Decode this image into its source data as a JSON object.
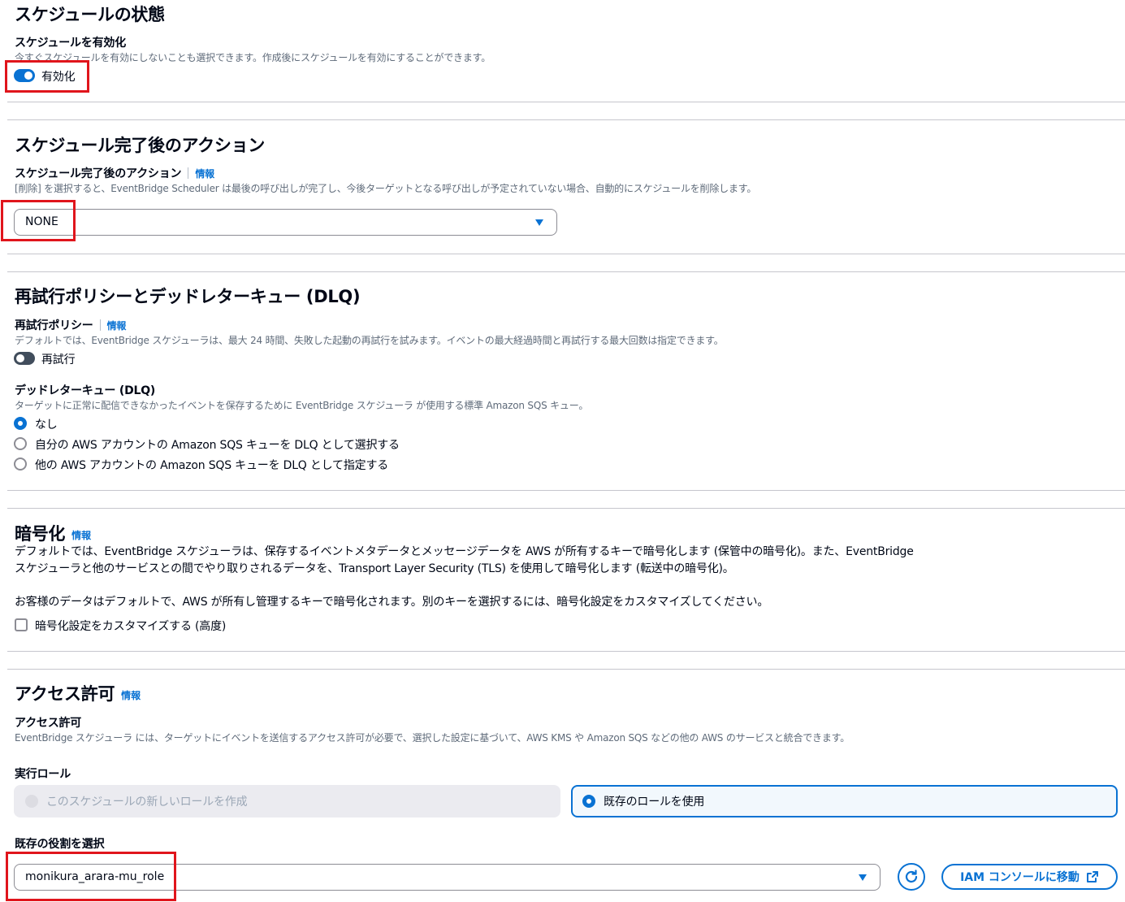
{
  "schedule_state": {
    "heading": "スケジュールの状態",
    "enable_label": "スケジュールを有効化",
    "enable_desc": "今すぐスケジュールを有効にしないことも選択できます。作成後にスケジュールを有効にすることができます。",
    "toggle_label": "有効化",
    "toggle_on": true
  },
  "completion_action": {
    "heading": "スケジュール完了後のアクション",
    "label": "スケジュール完了後のアクション",
    "info": "情報",
    "desc": "[削除] を選択すると、EventBridge Scheduler は最後の呼び出しが完了し、今後ターゲットとなる呼び出しが予定されていない場合、自動的にスケジュールを削除します。",
    "selected": "NONE"
  },
  "retry_dlq": {
    "heading": "再試行ポリシーとデッドレターキュー (DLQ)",
    "retry_label": "再試行ポリシー",
    "info": "情報",
    "retry_desc": "デフォルトでは、EventBridge スケジューラは、最大 24 時間、失敗した起動の再試行を試みます。イベントの最大経過時間と再試行する最大回数は指定できます。",
    "retry_toggle_label": "再試行",
    "retry_on": false,
    "dlq_label": "デッドレターキュー (DLQ)",
    "dlq_desc": "ターゲットに正常に配信できなかったイベントを保存するために EventBridge スケジューラ が使用する標準 Amazon SQS キュー。",
    "options": [
      "なし",
      "自分の AWS アカウントの Amazon SQS キューを DLQ として選択する",
      "他の AWS アカウントの Amazon SQS キューを DLQ として指定する"
    ],
    "selected_index": 0
  },
  "encryption": {
    "heading": "暗号化",
    "info": "情報",
    "para1_line1": "デフォルトでは、EventBridge スケジューラは、保存するイベントメタデータとメッセージデータを AWS が所有するキーで暗号化します (保管中の暗号化)。また、EventBridge",
    "para1_line2": "スケジューラと他のサービスとの間でやり取りされるデータを、Transport Layer Security (TLS) を使用して暗号化します (転送中の暗号化)。",
    "para2": "お客様のデータはデフォルトで、AWS が所有し管理するキーで暗号化されます。別のキーを選択するには、暗号化設定をカスタマイズしてください。",
    "checkbox_label": "暗号化設定をカスタマイズする (高度)",
    "checked": false
  },
  "access": {
    "heading": "アクセス許可",
    "info": "情報",
    "label": "アクセス許可",
    "desc": "EventBridge スケジューラ には、ターゲットにイベントを送信するアクセス許可が必要で、選択した設定に基づいて、AWS KMS や Amazon SQS などの他の AWS のサービスと統合できます。",
    "role_label": "実行ロール",
    "tile_new": "このスケジュールの新しいロールを作成",
    "tile_existing": "既存のロールを使用",
    "existing_label": "既存の役割を選択",
    "role_value": "monikura_arara-mu_role",
    "iam_button": "IAM コンソールに移動",
    "refresh_icon": "refresh-icon",
    "external_icon": "external-link-icon"
  },
  "colors": {
    "accent": "#0972d3",
    "highlight": "#e0151c",
    "text": "#000716",
    "muted": "#5f6b7a"
  }
}
